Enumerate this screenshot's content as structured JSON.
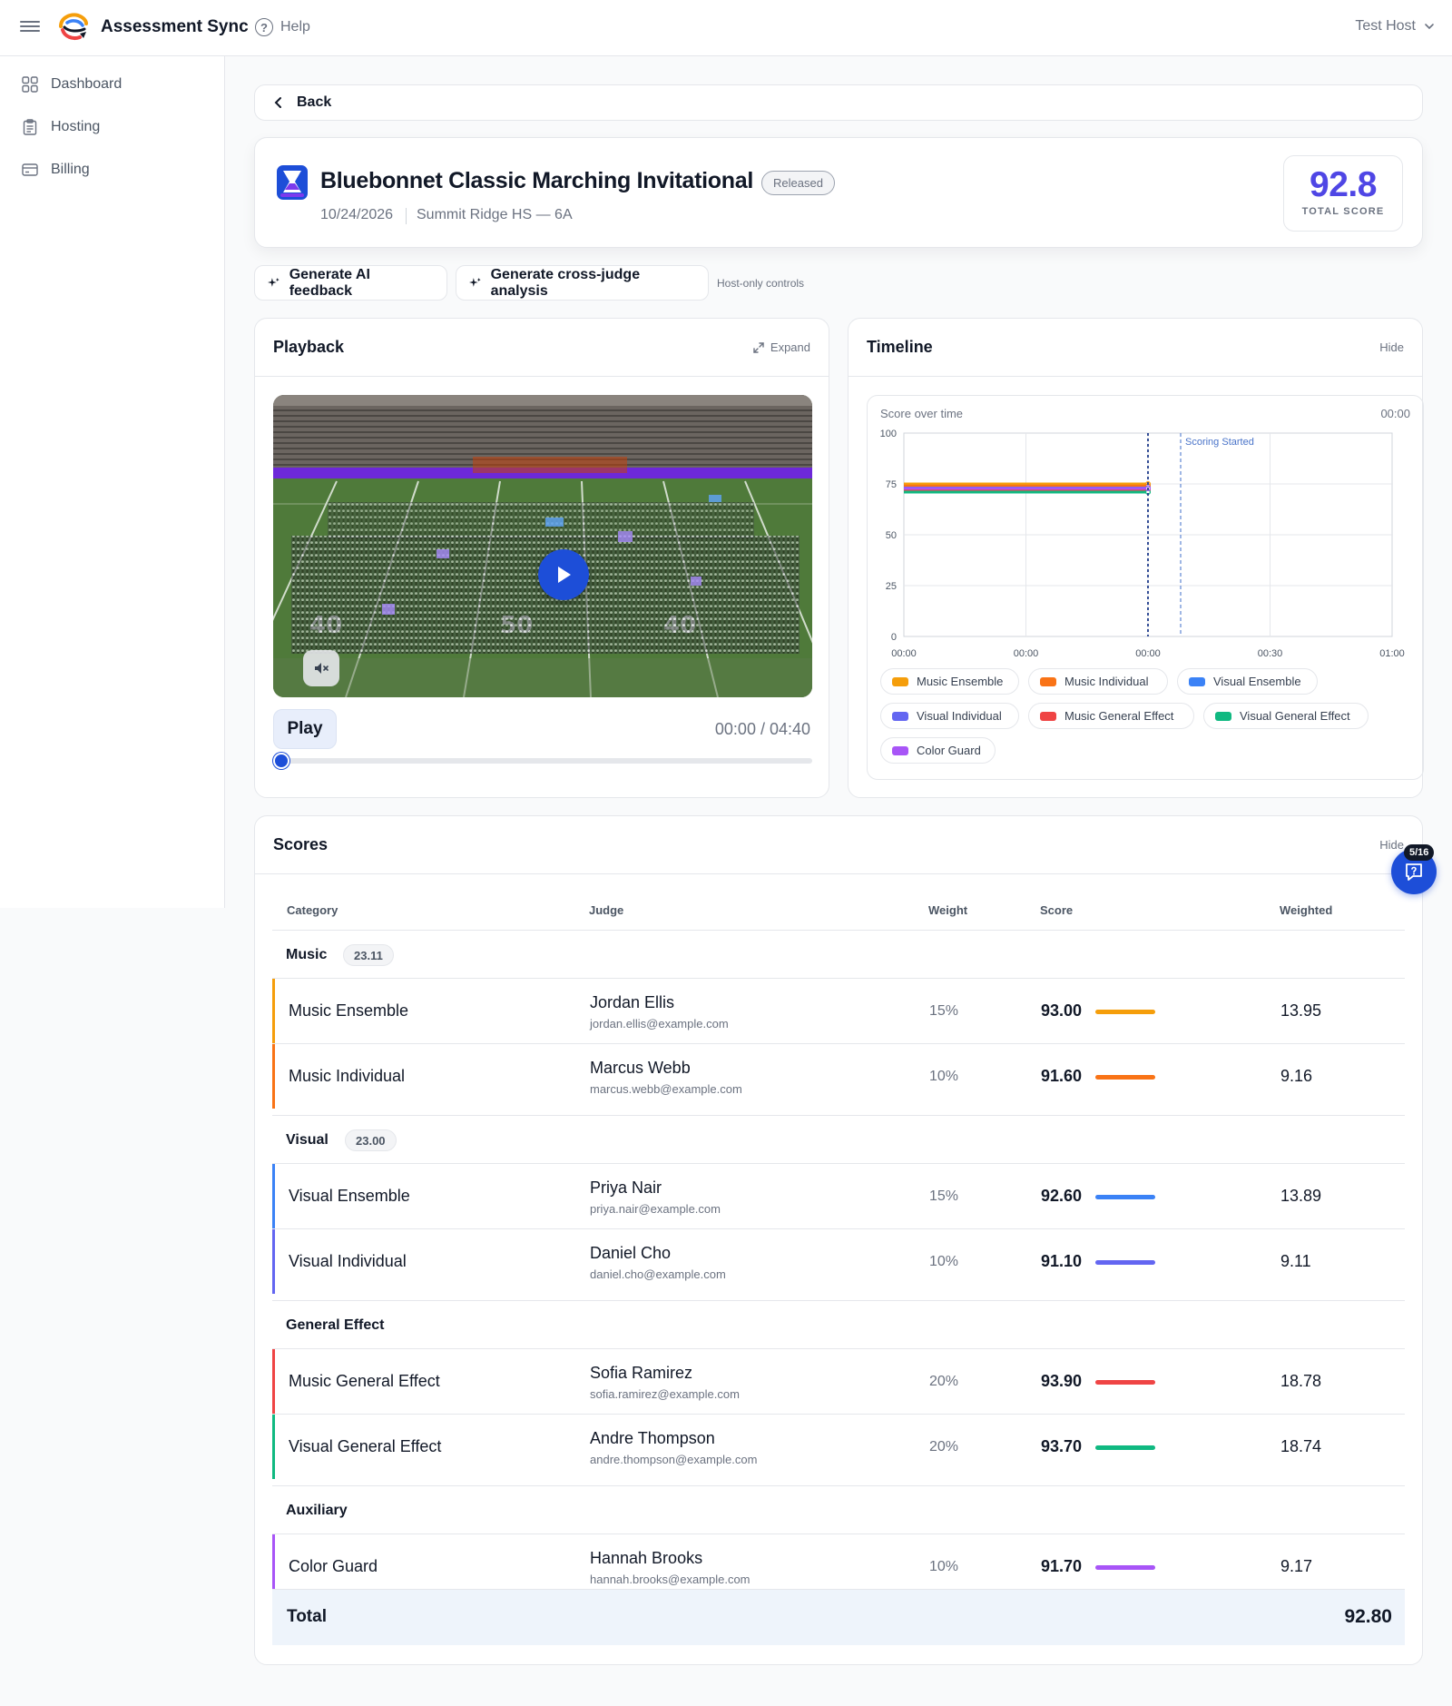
{
  "app": {
    "name": "Assessment Sync",
    "help_label": "Help",
    "user_label": "Test Host"
  },
  "sidebar": {
    "items": [
      {
        "label": "Dashboard",
        "icon": "grid-icon"
      },
      {
        "label": "Hosting",
        "icon": "clipboard-icon"
      },
      {
        "label": "Billing",
        "icon": "credit-card-icon"
      }
    ]
  },
  "back_label": "Back",
  "event": {
    "title": "Bluebonnet Classic Marching Invitational",
    "status": "Released",
    "date": "10/24/2026",
    "school": "Summit Ridge HS — 6A",
    "total_score": "92.8",
    "total_score_label": "TOTAL SCORE"
  },
  "actions": {
    "ai_feedback": "Generate AI feedback",
    "cross_judge": "Generate cross-judge analysis",
    "host_note": "Host-only controls"
  },
  "playback": {
    "title": "Playback",
    "expand_label": "Expand",
    "play_label": "Play",
    "timecode": "00:00 / 04:40",
    "progress": 0
  },
  "timeline": {
    "title": "Timeline",
    "hide_label": "Hide",
    "chart_label": "Score over time",
    "chart_time": "00:00"
  },
  "chart_data": {
    "type": "line",
    "title": "Score over time",
    "y_ticks": [
      "100",
      "75",
      "50",
      "25",
      "0"
    ],
    "x_ticks": [
      "00:00",
      "00:00",
      "00:00",
      "00:30",
      "01:00"
    ],
    "ylim": [
      0,
      100
    ],
    "annotation": "Scoring Started",
    "series": [
      {
        "name": "Music Ensemble",
        "color": "#f59e0b",
        "value": 75
      },
      {
        "name": "Music Individual",
        "color": "#f97316",
        "value": 74
      },
      {
        "name": "Visual Ensemble",
        "color": "#3b82f6",
        "value": 73
      },
      {
        "name": "Visual Individual",
        "color": "#6366f1",
        "value": 72.5
      },
      {
        "name": "Music General Effect",
        "color": "#ef4444",
        "value": 72
      },
      {
        "name": "Visual General Effect",
        "color": "#10b981",
        "value": 71
      },
      {
        "name": "Color Guard",
        "color": "#a855f7",
        "value": 72.8
      }
    ]
  },
  "scores": {
    "title": "Scores",
    "hide_label": "Hide",
    "columns": [
      "Category",
      "Judge",
      "Weight",
      "Score",
      "Weighted"
    ],
    "groups": [
      {
        "name": "Music",
        "badge": "23.11",
        "rows": [
          {
            "category": "Music Ensemble",
            "judge": "Jordan Ellis",
            "email": "jordan.ellis@example.com",
            "weight": "15%",
            "score": "93.00",
            "weighted": "13.95",
            "color": "#f59e0b"
          },
          {
            "category": "Music Individual",
            "judge": "Marcus Webb",
            "email": "marcus.webb@example.com",
            "weight": "10%",
            "score": "91.60",
            "weighted": "9.16",
            "color": "#f97316"
          }
        ]
      },
      {
        "name": "Visual",
        "badge": "23.00",
        "rows": [
          {
            "category": "Visual Ensemble",
            "judge": "Priya Nair",
            "email": "priya.nair@example.com",
            "weight": "15%",
            "score": "92.60",
            "weighted": "13.89",
            "color": "#3b82f6"
          },
          {
            "category": "Visual Individual",
            "judge": "Daniel Cho",
            "email": "daniel.cho@example.com",
            "weight": "10%",
            "score": "91.10",
            "weighted": "9.11",
            "color": "#6366f1"
          }
        ]
      },
      {
        "name": "General Effect",
        "badge": "",
        "rows": [
          {
            "category": "Music General Effect",
            "judge": "Sofia Ramirez",
            "email": "sofia.ramirez@example.com",
            "weight": "20%",
            "score": "93.90",
            "weighted": "18.78",
            "color": "#ef4444"
          },
          {
            "category": "Visual General Effect",
            "judge": "Andre Thompson",
            "email": "andre.thompson@example.com",
            "weight": "20%",
            "score": "93.70",
            "weighted": "18.74",
            "color": "#10b981"
          }
        ]
      },
      {
        "name": "Auxiliary",
        "badge": "",
        "rows": [
          {
            "category": "Color Guard",
            "judge": "Hannah Brooks",
            "email": "hannah.brooks@example.com",
            "weight": "10%",
            "score": "91.70",
            "weighted": "9.17",
            "color": "#a855f7"
          }
        ]
      }
    ],
    "total_label": "Total",
    "total_value": "92.80"
  },
  "help_fab": {
    "badge": "5/16"
  }
}
